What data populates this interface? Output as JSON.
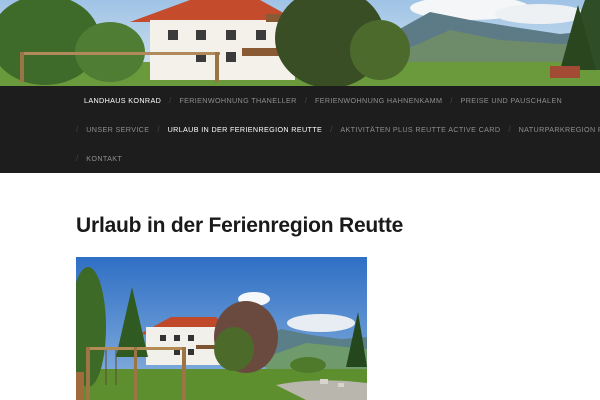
{
  "nav": {
    "rows": [
      [
        {
          "label": "Landhaus Konrad",
          "active": true
        },
        {
          "label": "Ferienwohnung Thaneller",
          "active": false
        },
        {
          "label": "Ferienwohnung Hahnenkamm",
          "active": false
        },
        {
          "label": "Preise und Pauschalen",
          "active": false
        }
      ],
      [
        {
          "label": "Unser Service",
          "active": false
        },
        {
          "label": "Urlaub in der Ferienregion Reutte",
          "active": true
        },
        {
          "label": "Aktivitäten plus Reutte Active Card",
          "active": false
        },
        {
          "label": "Naturparkregion Reutte",
          "active": false
        }
      ],
      [
        {
          "label": "Kontakt",
          "active": false
        }
      ]
    ],
    "separator": "/",
    "active_color": "#ffffff",
    "inactive_color": "#8e8e8e",
    "background": "#1d1d1d"
  },
  "page": {
    "title": "Urlaub in der Ferienregion Reutte"
  },
  "images": {
    "header": "header-photo-landhaus",
    "content": "content-photo-landhaus-garden"
  }
}
